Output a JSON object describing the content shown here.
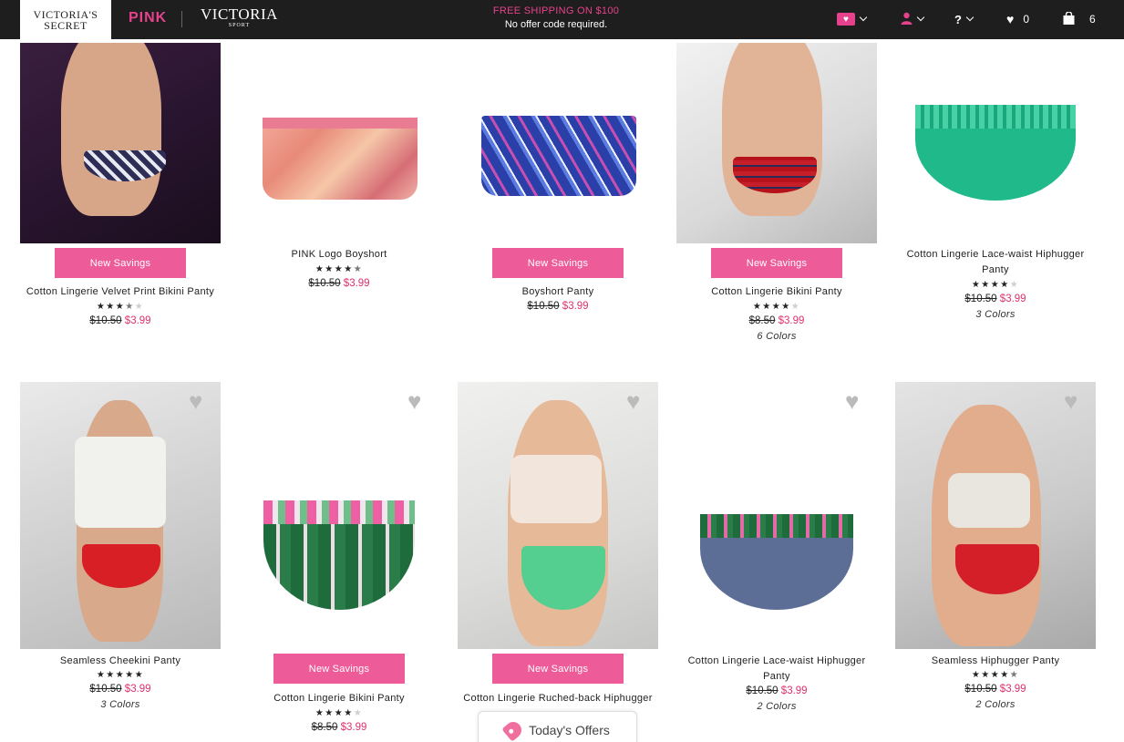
{
  "header": {
    "brand_vs_line1": "VICTORIA'S",
    "brand_vs_line2": "SECRET",
    "brand_pink": "PINK",
    "brand_sport_big": "VICTORIA",
    "brand_sport_small": "SPORT",
    "promo_line1": "FREE SHIPPING ON $100",
    "promo_line2": "No offer code required.",
    "wishlist_icon": "heart-icon",
    "account_icon": "user-icon",
    "help_label": "?",
    "favorites_count": "0",
    "bag_count": "6"
  },
  "products": [
    {
      "name": "Cotton Lingerie Velvet Print Bikini Panty",
      "badge": "New Savings",
      "stars": "★★★",
      "half": "★",
      "empty": "★",
      "was": "$10.50",
      "now": "$3.99",
      "colors": ""
    },
    {
      "name": "PINK Logo Boyshort",
      "badge": "",
      "stars": "★★★★",
      "half": "★",
      "empty": "",
      "was": "$10.50",
      "now": "$3.99",
      "colors": ""
    },
    {
      "name": "Boyshort Panty",
      "badge": "New Savings",
      "stars": "",
      "half": "",
      "empty": "",
      "was": "$10.50",
      "now": "$3.99",
      "colors": ""
    },
    {
      "name": "Cotton Lingerie Bikini Panty",
      "badge": "New Savings",
      "stars": "★★★★",
      "half": "",
      "empty": "★",
      "was": "$8.50",
      "now": "$3.99",
      "colors": "6 Colors"
    },
    {
      "name_line1": "Cotton Lingerie Lace-waist Hiphugger",
      "name_line2": "Panty",
      "badge": "",
      "stars": "★★★★",
      "half": "",
      "empty": "★",
      "was": "$10.50",
      "now": "$3.99",
      "colors": "3 Colors"
    },
    {
      "name": "Seamless Cheekini Panty",
      "badge": "",
      "stars": "★★★★★",
      "half": "",
      "empty": "",
      "was": "$10.50",
      "now": "$3.99",
      "colors": "3 Colors"
    },
    {
      "name": "Cotton Lingerie Bikini Panty",
      "badge": "New Savings",
      "stars": "★★★★",
      "half": "",
      "empty": "★",
      "was": "$8.50",
      "now": "$3.99",
      "colors": ""
    },
    {
      "name": "Cotton Lingerie Ruched-back Hiphugger",
      "badge": "New Savings",
      "stars": "",
      "half": "",
      "empty": "",
      "was": "",
      "now": "",
      "colors": ""
    },
    {
      "name_line1": "Cotton Lingerie Lace-waist Hiphugger",
      "name_line2": "Panty",
      "badge": "",
      "stars": "",
      "half": "",
      "empty": "",
      "was": "$10.50",
      "now": "$3.99",
      "colors": "2 Colors"
    },
    {
      "name": "Seamless Hiphugger Panty",
      "badge": "",
      "stars": "★★★★",
      "half": "★",
      "empty": "",
      "was": "$10.50",
      "now": "$3.99",
      "colors": "2 Colors"
    }
  ],
  "offers_tab": {
    "label": "Today's Offers",
    "icon": "tag-icon"
  },
  "fav_icon": "♥",
  "colors": {
    "brand_pink": "#e6428c",
    "button_pink": "#ee5b99",
    "sale_price": "#e0306f",
    "topbar": "#1e1e1e"
  }
}
